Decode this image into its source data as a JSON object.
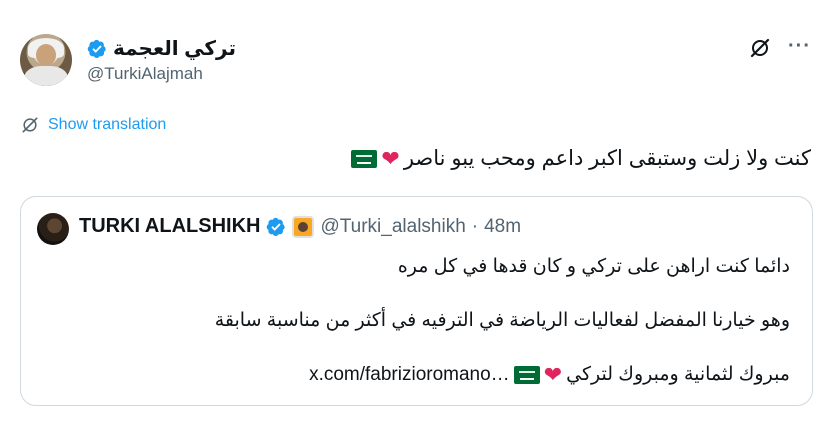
{
  "author": {
    "display_name": "تركي العجمة",
    "handle": "@TurkiAlajmah",
    "verified": true
  },
  "actions": {
    "grok_icon": "grok-slash-icon",
    "more_icon": "more-options-icon",
    "more_label": "···"
  },
  "translation": {
    "label": "Show translation",
    "icon": "translate-icon"
  },
  "tweet": {
    "text": "كنت ولا زلت وستبقى اكبر داعم ومحب يبو ناصر",
    "emojis": [
      "red-heart",
      "saudi-flag"
    ],
    "heart": "❤"
  },
  "quoted_tweet": {
    "author_name": "TURKI ALALSHIKH",
    "handle": "@Turki_alalshikh",
    "separator": "·",
    "time": "48m",
    "line1": "دائما كنت اراهن على تركي و كان قدها في كل مره",
    "line2": "وهو خيارنا المفضل لفعاليات الرياضة في الترفيه في أكثر من مناسبة سابقة",
    "line3_text": "مبروك لثمانية ومبروك لتركي",
    "line3_link": "x.com/fabrizioromano…",
    "heart": "❤"
  },
  "colors": {
    "accent": "#1d9bf0",
    "text": "#0f1419",
    "muted": "#536471",
    "border": "#cfd9de",
    "heart": "#e0245e",
    "flag_green": "#006c35"
  }
}
